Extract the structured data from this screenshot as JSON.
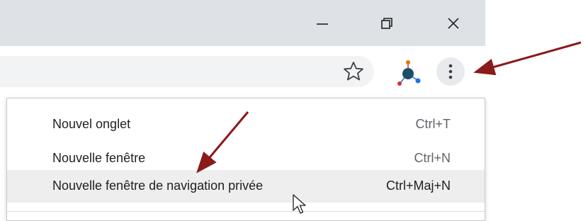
{
  "window_controls": {
    "minimize_icon": "minimize-icon",
    "restore_icon": "restore-icon",
    "close_icon": "close-icon"
  },
  "toolbar": {
    "bookmark_icon": "star-icon",
    "extension_icon": "extension-icon",
    "menu_icon": "three-dots-vertical-icon"
  },
  "menu": {
    "items": [
      {
        "label": "Nouvel onglet",
        "shortcut": "Ctrl+T"
      },
      {
        "label": "Nouvelle fenêtre",
        "shortcut": "Ctrl+N"
      },
      {
        "label": "Nouvelle fenêtre de navigation privée",
        "shortcut": "Ctrl+Maj+N"
      }
    ],
    "highlighted_index": 2
  },
  "colors": {
    "titlebar": "#dee1e6",
    "annotation_arrow": "#8b1a1a",
    "menu_highlight": "#eeeeee"
  }
}
